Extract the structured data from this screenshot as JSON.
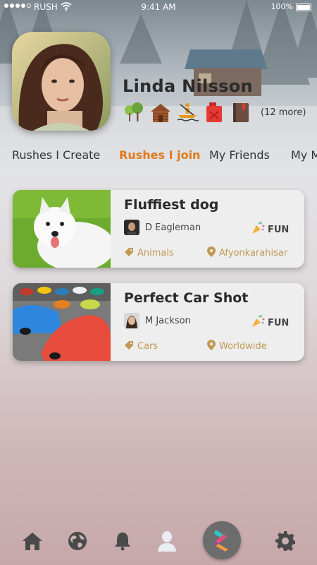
{
  "status_bar": {
    "carrier": "RUSH",
    "time": "9:41 AM",
    "battery": "100%"
  },
  "profile": {
    "name": "Linda Nilsson",
    "more_interests": "(12 more)",
    "interests": [
      "tree-icon",
      "cabin-icon",
      "rowing-icon",
      "fuel-can-icon",
      "book-icon"
    ]
  },
  "tabs": [
    {
      "label": "Rushes I Create"
    },
    {
      "label": "Rushes I join",
      "active": true
    },
    {
      "label": "My Friends"
    },
    {
      "label": "My M"
    }
  ],
  "cards": [
    {
      "title": "Fluffiest dog",
      "author": "D Eagleman",
      "type": "FUN",
      "category": "Animals",
      "location": "Afyonkarahisar"
    },
    {
      "title": "Perfect Car Shot",
      "author": "M Jackson",
      "type": "FUN",
      "category": "Cars",
      "location": "Worldwide"
    }
  ],
  "nav": [
    "home-icon",
    "globe-icon",
    "bell-icon",
    "user-icon",
    "rush-logo-icon",
    "gear-icon"
  ],
  "colors": {
    "accent": "#e07a1a",
    "meta": "#c09a55"
  }
}
